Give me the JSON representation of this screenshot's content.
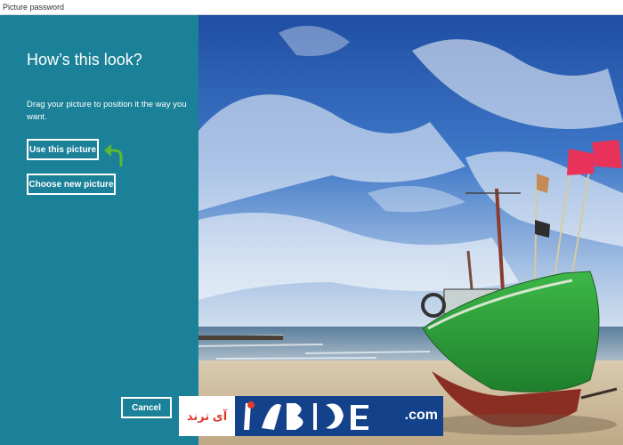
{
  "window": {
    "title": "Picture password"
  },
  "panel": {
    "heading": "How’s this look?",
    "instructions": "Drag your picture to position it the way you want.",
    "use_picture_label": "Use this picture",
    "choose_new_label": "Choose new picture",
    "cancel_label": "Cancel",
    "arrow_icon": "curved-arrow-icon"
  },
  "watermark": {
    "text_fa": "آی ترند",
    "text_com": ".com"
  },
  "colors": {
    "panel_bg": "#1b8198",
    "arrow_green": "#5cb833",
    "boat_hull": "#2f9e3a",
    "sky": "#2a5fb0"
  }
}
